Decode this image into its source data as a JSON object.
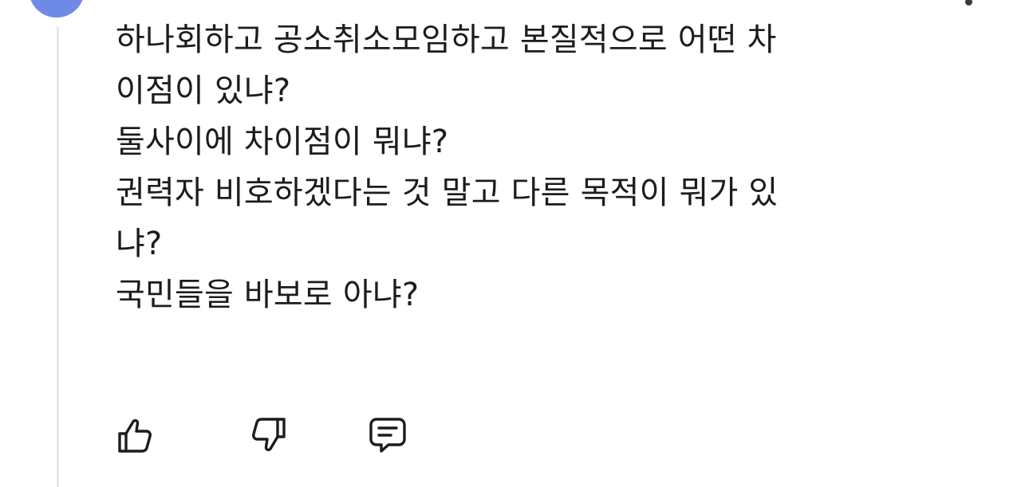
{
  "comment": {
    "lines": [
      "하나회하고 공소취소모임하고 본질적으로 어떤 차",
      "이점이 있냐?",
      "둘사이에 차이점이 뭐냐?",
      "권력자 비호하겠다는 것 말고 다른 목적이 뭐가 있",
      "냐?",
      "국민들을 바보로 아냐?"
    ]
  },
  "actions": {
    "icons": [
      "thumbs-up-icon",
      "thumbs-down-icon",
      "comment-icon"
    ]
  },
  "colors": {
    "avatar": "#6f8ae6",
    "thread_line": "#e6e6e8",
    "text": "#1c1c1c"
  }
}
